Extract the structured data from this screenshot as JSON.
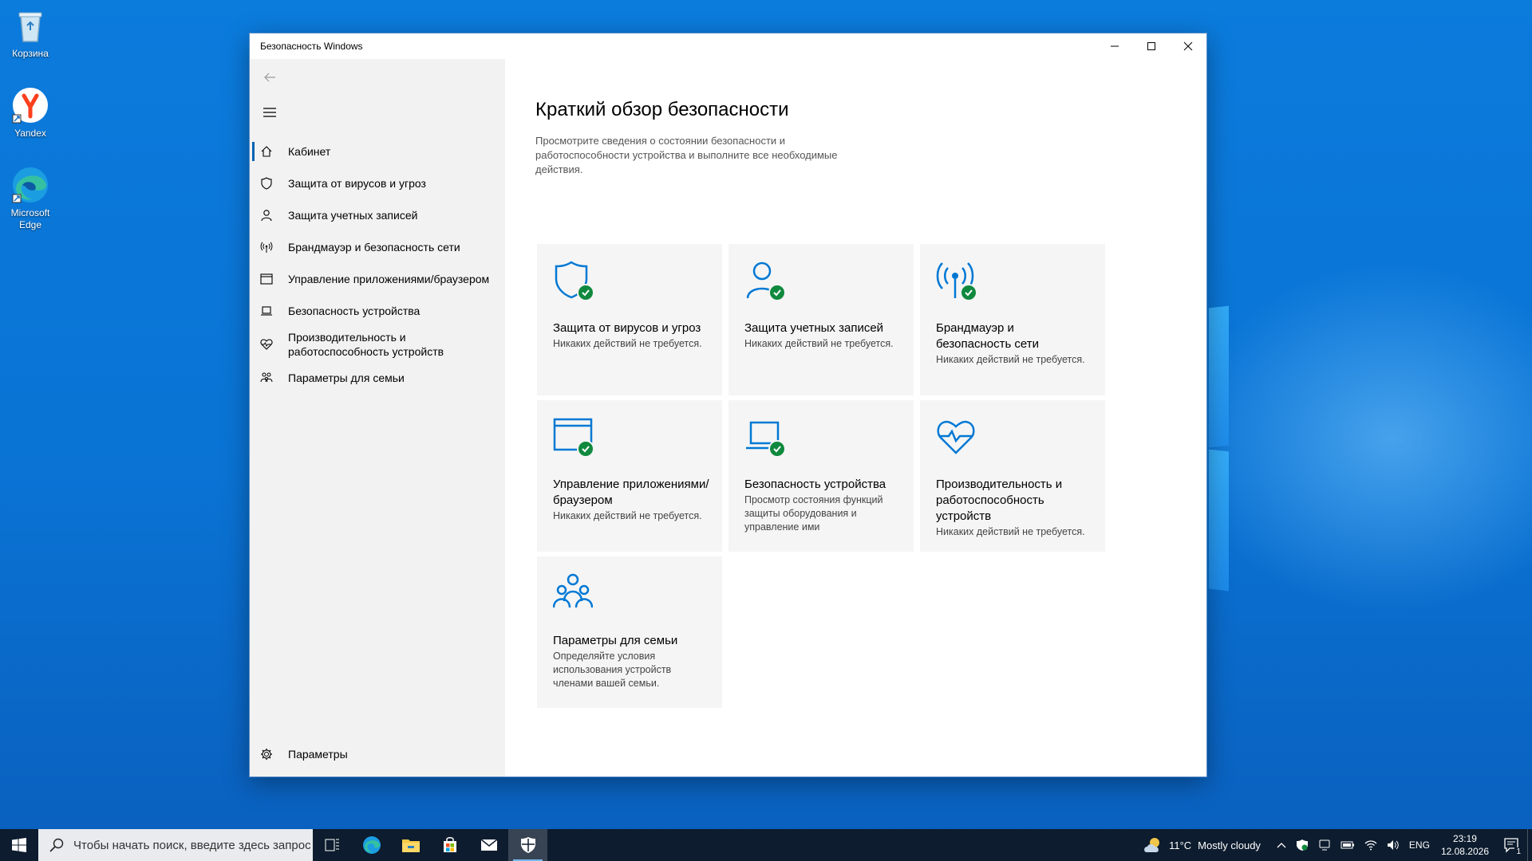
{
  "desktop": {
    "icons": [
      {
        "label": "Корзина"
      },
      {
        "label": "Yandex"
      },
      {
        "label": "Microsoft Edge"
      }
    ]
  },
  "window": {
    "title": "Безопасность Windows",
    "sidebar": {
      "items": [
        {
          "label": "Кабинет",
          "icon": "home-icon",
          "active": true
        },
        {
          "label": "Защита от вирусов и угроз",
          "icon": "shield-icon"
        },
        {
          "label": "Защита учетных записей",
          "icon": "person-icon"
        },
        {
          "label": "Брандмауэр и безопасность сети",
          "icon": "antenna-icon"
        },
        {
          "label": "Управление приложениями/браузером",
          "icon": "browser-icon"
        },
        {
          "label": "Безопасность устройства",
          "icon": "laptop-icon"
        },
        {
          "label": "Производительность и работоспособность устройств",
          "icon": "heart-icon"
        },
        {
          "label": "Параметры для семьи",
          "icon": "family-icon"
        }
      ],
      "settings_label": "Параметры"
    },
    "main": {
      "title": "Краткий обзор безопасности",
      "description": "Просмотрите сведения о состоянии безопасности и работоспособности устройства и выполните все необходимые действия.",
      "tiles": [
        {
          "title": "Защита от вирусов и угроз",
          "subtitle": "Никаких действий не требуется.",
          "icon": "shield-icon",
          "status": "ok"
        },
        {
          "title": "Защита учетных записей",
          "subtitle": "Никаких действий не требуется.",
          "icon": "person-icon",
          "status": "ok"
        },
        {
          "title": "Брандмауэр и безопасность сети",
          "subtitle": "Никаких действий не требуется.",
          "icon": "antenna-icon",
          "status": "ok"
        },
        {
          "title": "Управление приложениями/браузером",
          "subtitle": "Никаких действий не требуется.",
          "icon": "browser-icon",
          "status": "ok"
        },
        {
          "title": "Безопасность устройства",
          "subtitle": "Просмотр состояния функций защиты оборудования и управление ими",
          "icon": "laptop-icon",
          "status": "ok"
        },
        {
          "title": "Производительность и работоспособность устройств",
          "subtitle": "Никаких действий не требуется.",
          "icon": "heart-icon",
          "status": "none"
        },
        {
          "title": "Параметры для семьи",
          "subtitle": "Определяйте условия использования устройств членами вашей семьи.",
          "icon": "family-icon",
          "status": "none"
        }
      ]
    }
  },
  "taskbar": {
    "search_placeholder": "Чтобы начать поиск, введите здесь запрос",
    "weather": {
      "temp": "11°C",
      "condition": "Mostly cloudy"
    },
    "language": "ENG",
    "time": "23:19",
    "date": "12.08.2026",
    "notification_count": "1"
  },
  "colors": {
    "accent": "#0063b1",
    "icon_blue": "#0078d4",
    "ok_green": "#10893e"
  }
}
